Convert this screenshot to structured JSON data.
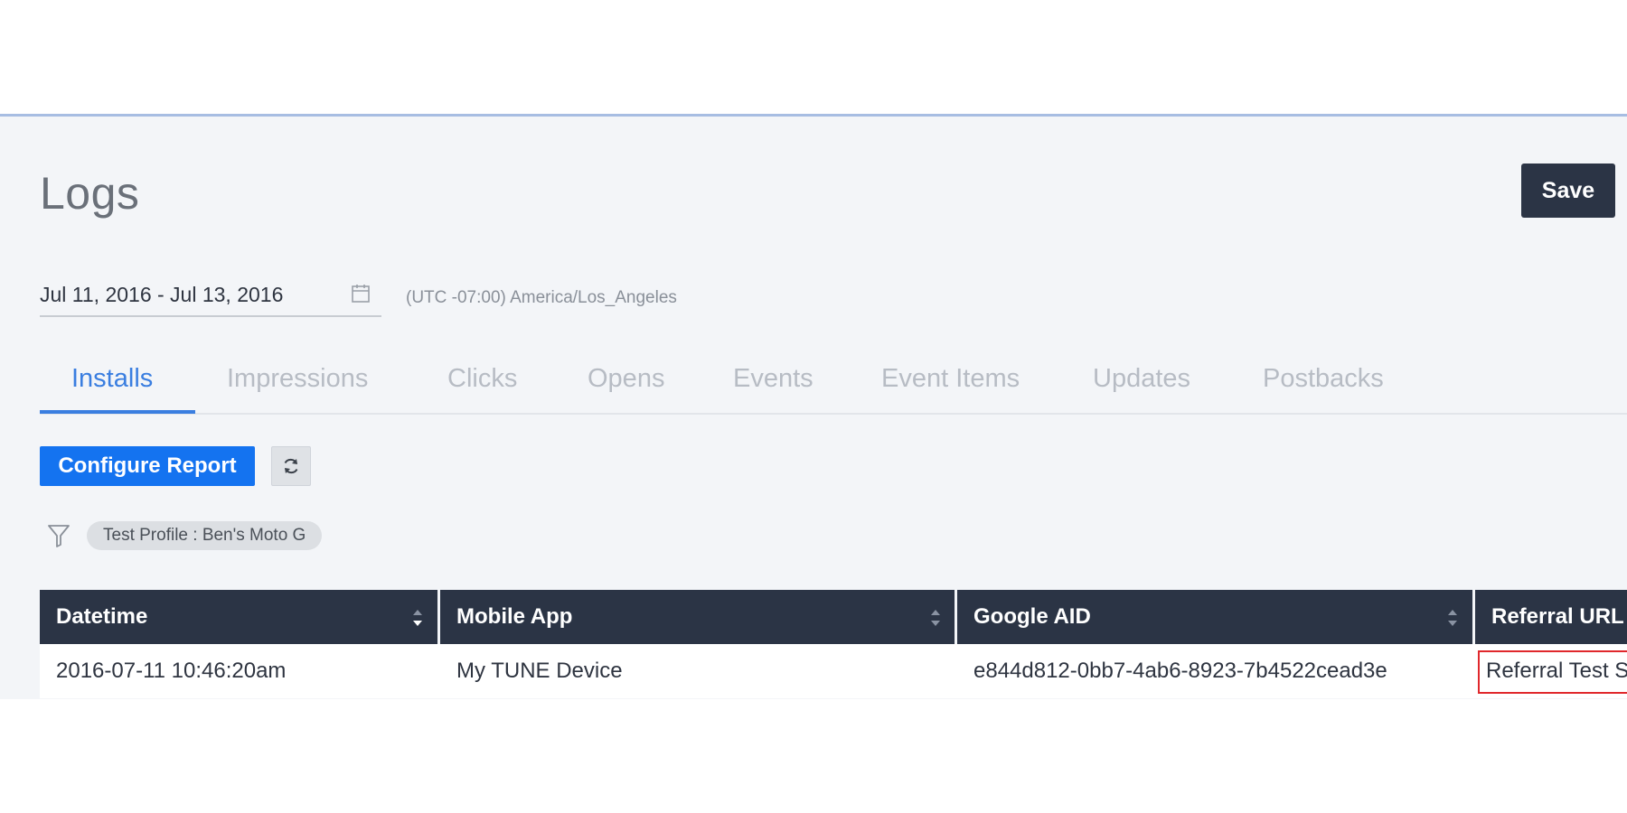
{
  "header": {
    "title": "Logs",
    "save_label": "Save"
  },
  "date_filter": {
    "range": "Jul 11, 2016 - Jul 13, 2016",
    "timezone": "(UTC -07:00) America/Los_Angeles"
  },
  "tabs": [
    {
      "label": "Installs",
      "active": true
    },
    {
      "label": "Impressions",
      "active": false
    },
    {
      "label": "Clicks",
      "active": false
    },
    {
      "label": "Opens",
      "active": false
    },
    {
      "label": "Events",
      "active": false
    },
    {
      "label": "Event Items",
      "active": false
    },
    {
      "label": "Updates",
      "active": false
    },
    {
      "label": "Postbacks",
      "active": false
    }
  ],
  "toolbar": {
    "configure_label": "Configure Report",
    "refresh_icon": "refresh-icon"
  },
  "filters": {
    "icon": "filter-icon",
    "chips": [
      "Test Profile : Ben's Moto G"
    ]
  },
  "table": {
    "columns": [
      "Datetime",
      "Mobile App",
      "Google AID",
      "Referral URL"
    ],
    "rows": [
      [
        "2016-07-11 10:46:20am",
        "My TUNE Device",
        "e844d812-0bb7-4ab6-8923-7b4522cead3e",
        "Referral Test S"
      ]
    ],
    "highlight_color": "#e0282c"
  },
  "colors": {
    "accent": "#1473f0",
    "dark": "#2b3445",
    "tab_active": "#3a7ee0"
  }
}
